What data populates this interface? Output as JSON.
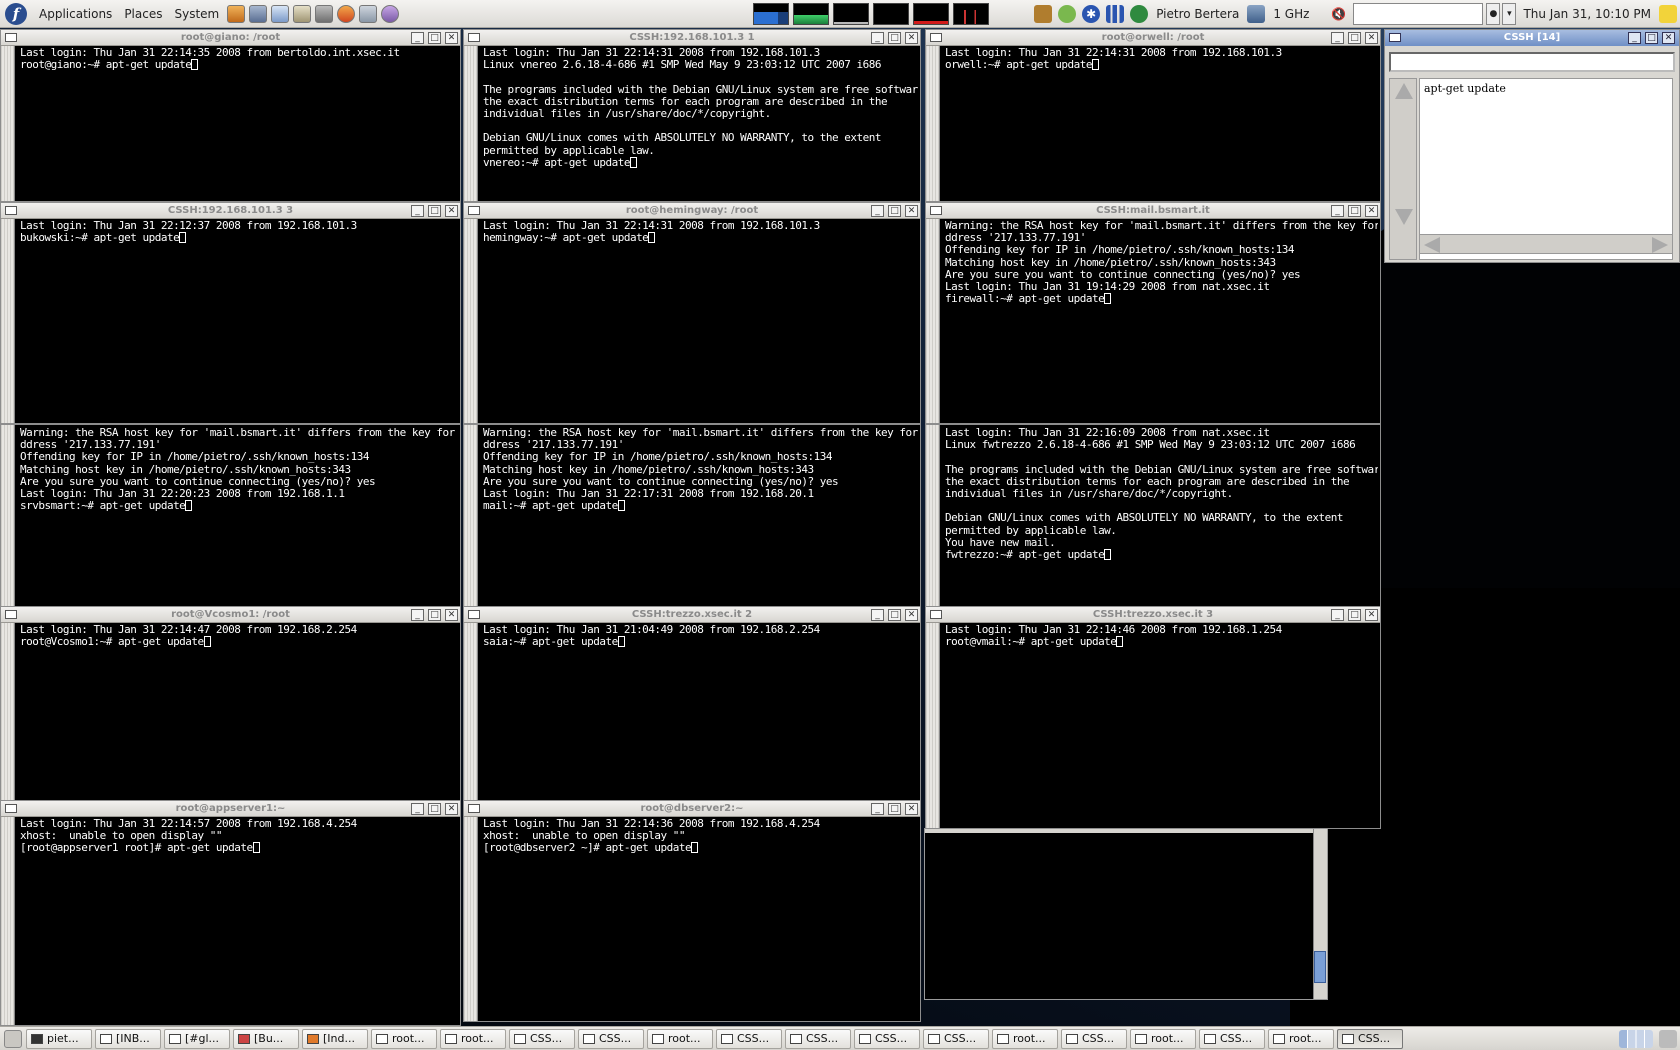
{
  "top_panel": {
    "menus": [
      "Applications",
      "Places",
      "System"
    ],
    "user_name": "Pietro Bertera",
    "cpu_freq": "1 GHz",
    "clock": "Thu Jan 31, 10:10 PM"
  },
  "terminals": [
    {
      "title": "root@giano: /root",
      "lines": [
        "Last login: Thu Jan 31 22:14:35 2008 from bertoldo.int.xsec.it",
        "root@giano:~# apt-get update"
      ]
    },
    {
      "title": "CSSH:192.168.101.3 1",
      "lines": [
        "Last login: Thu Jan 31 22:14:31 2008 from 192.168.101.3",
        "Linux vnereo 2.6.18-4-686 #1 SMP Wed May 9 23:03:12 UTC 2007 i686",
        "",
        "The programs included with the Debian GNU/Linux system are free software;",
        "the exact distribution terms for each program are described in the",
        "individual files in /usr/share/doc/*/copyright.",
        "",
        "Debian GNU/Linux comes with ABSOLUTELY NO WARRANTY, to the extent",
        "permitted by applicable law.",
        "vnereo:~# apt-get update"
      ]
    },
    {
      "title": "root@orwell: /root",
      "lines": [
        "Last login: Thu Jan 31 22:14:31 2008 from 192.168.101.3",
        "orwell:~# apt-get update"
      ]
    },
    {
      "title": "CSSH:192.168.101.3 3",
      "lines": [
        "Last login: Thu Jan 31 22:12:37 2008 from 192.168.101.3",
        "bukowski:~# apt-get update"
      ]
    },
    {
      "title": "root@hemingway: /root",
      "lines": [
        "Last login: Thu Jan 31 22:14:31 2008 from 192.168.101.3",
        "hemingway:~# apt-get update"
      ]
    },
    {
      "title": "CSSH:mail.bsmart.it",
      "lines": [
        "Warning: the RSA host key for 'mail.bsmart.it' differs from the key for t",
        "ddress '217.133.77.191'",
        "Offending key for IP in /home/pietro/.ssh/known_hosts:134",
        "Matching host key in /home/pietro/.ssh/known_hosts:343",
        "Are you sure you want to continue connecting (yes/no)? yes",
        "Last login: Thu Jan 31 19:14:29 2008 from nat.xsec.it",
        "firewall:~# apt-get update"
      ]
    },
    {
      "title": "",
      "lines": [
        "Warning: the RSA host key for 'mail.bsmart.it' differs from the key for t",
        "ddress '217.133.77.191'",
        "Offending key for IP in /home/pietro/.ssh/known_hosts:134",
        "Matching host key in /home/pietro/.ssh/known_hosts:343",
        "Are you sure you want to continue connecting (yes/no)? yes",
        "Last login: Thu Jan 31 22:20:23 2008 from 192.168.1.1",
        "srvbsmart:~# apt-get update"
      ]
    },
    {
      "title": "",
      "lines": [
        "Warning: the RSA host key for 'mail.bsmart.it' differs from the key for t",
        "ddress '217.133.77.191'",
        "Offending key for IP in /home/pietro/.ssh/known_hosts:134",
        "Matching host key in /home/pietro/.ssh/known_hosts:343",
        "Are you sure you want to continue connecting (yes/no)? yes",
        "Last login: Thu Jan 31 22:17:31 2008 from 192.168.20.1",
        "mail:~# apt-get update"
      ]
    },
    {
      "title": "",
      "lines": [
        "Last login: Thu Jan 31 22:16:09 2008 from nat.xsec.it",
        "Linux fwtrezzo 2.6.18-4-686 #1 SMP Wed May 9 23:03:12 UTC 2007 i686",
        "",
        "The programs included with the Debian GNU/Linux system are free software;",
        "the exact distribution terms for each program are described in the",
        "individual files in /usr/share/doc/*/copyright.",
        "",
        "Debian GNU/Linux comes with ABSOLUTELY NO WARRANTY, to the extent",
        "permitted by applicable law.",
        "You have new mail.",
        "fwtrezzo:~# apt-get update"
      ]
    },
    {
      "title": "root@Vcosmo1: /root",
      "lines": [
        "Last login: Thu Jan 31 22:14:47 2008 from 192.168.2.254",
        "root@Vcosmo1:~# apt-get update"
      ]
    },
    {
      "title": "CSSH:trezzo.xsec.it 2",
      "lines": [
        "Last login: Thu Jan 31 21:04:49 2008 from 192.168.2.254",
        "saia:~# apt-get update"
      ]
    },
    {
      "title": "CSSH:trezzo.xsec.it 3",
      "lines": [
        "Last login: Thu Jan 31 22:14:46 2008 from 192.168.1.254",
        "root@vmail:~# apt-get update"
      ]
    },
    {
      "title": "root@appserver1:~",
      "lines": [
        "Last login: Thu Jan 31 22:14:57 2008 from 192.168.4.254",
        "xhost:  unable to open display \"\"",
        "[root@appserver1 root]# apt-get update"
      ]
    },
    {
      "title": "root@dbserver2:~",
      "lines": [
        "Last login: Thu Jan 31 22:14:36 2008 from 192.168.4.254",
        "xhost:  unable to open display \"\"",
        "[root@dbserver2 ~]# apt-get update"
      ]
    }
  ],
  "cssh_window": {
    "title": "CSSH [14]",
    "input_value": "",
    "history_text": "apt-get update"
  },
  "taskbar": [
    {
      "label": "piet...",
      "icon": "terminal-icon"
    },
    {
      "label": "[INB...",
      "icon": "mail-icon"
    },
    {
      "label": "[#gl...",
      "icon": "chat-icon"
    },
    {
      "label": "[Bu...",
      "icon": "bug-icon"
    },
    {
      "label": "[Ind...",
      "icon": "firefox-icon"
    },
    {
      "label": "root...",
      "icon": "window-icon"
    },
    {
      "label": "root...",
      "icon": "window-icon"
    },
    {
      "label": "CSS...",
      "icon": "window-icon"
    },
    {
      "label": "CSS...",
      "icon": "window-icon"
    },
    {
      "label": "root...",
      "icon": "window-icon"
    },
    {
      "label": "CSS...",
      "icon": "window-icon"
    },
    {
      "label": "CSS...",
      "icon": "window-icon"
    },
    {
      "label": "CSS...",
      "icon": "window-icon"
    },
    {
      "label": "CSS...",
      "icon": "window-icon"
    },
    {
      "label": "root...",
      "icon": "window-icon"
    },
    {
      "label": "CSS...",
      "icon": "window-icon"
    },
    {
      "label": "root...",
      "icon": "window-icon"
    },
    {
      "label": "CSS...",
      "icon": "window-icon"
    },
    {
      "label": "root...",
      "icon": "window-icon"
    },
    {
      "label": "CSS...",
      "icon": "window-icon"
    }
  ],
  "colors": {
    "terminal_bg": "#000000",
    "terminal_fg": "#ffffff",
    "panel_bg": "#e8e6e2",
    "cssh_title": "#6f8fc6"
  }
}
